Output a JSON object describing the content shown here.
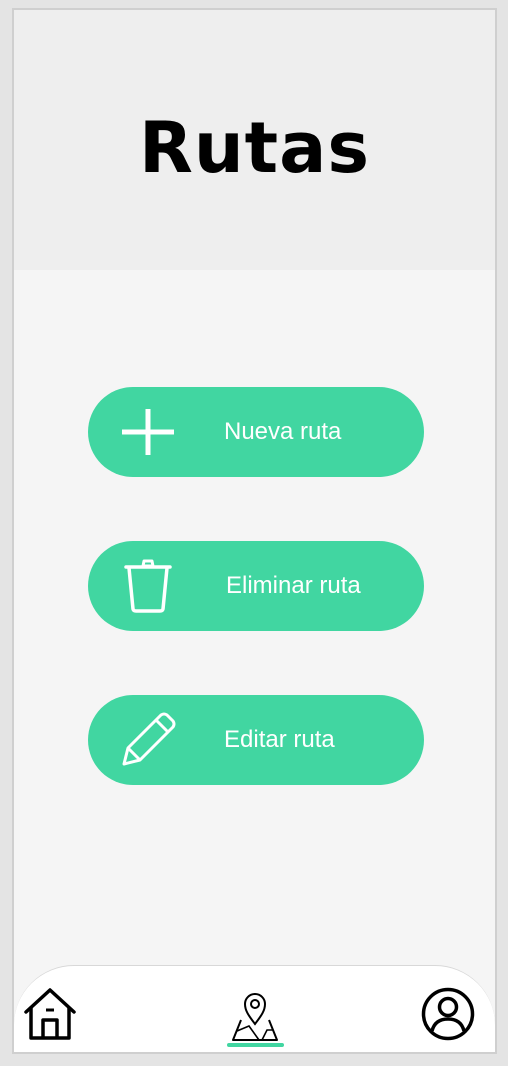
{
  "header": {
    "title": "Rutas"
  },
  "actions": {
    "new_route": {
      "label": "Nueva ruta",
      "icon": "plus-icon"
    },
    "delete_route": {
      "label": "Eliminar ruta",
      "icon": "trash-icon"
    },
    "edit_route": {
      "label": "Editar ruta",
      "icon": "pencil-icon"
    }
  },
  "bottom_nav": {
    "items": [
      {
        "icon": "home-icon",
        "active": false
      },
      {
        "icon": "map-pin-icon",
        "active": true
      },
      {
        "icon": "user-icon",
        "active": false
      }
    ]
  },
  "colors": {
    "accent": "#41d6a1",
    "header_bg": "#eeeeee",
    "page_bg": "#f5f5f5",
    "text": "#000000",
    "button_text": "#ffffff"
  }
}
